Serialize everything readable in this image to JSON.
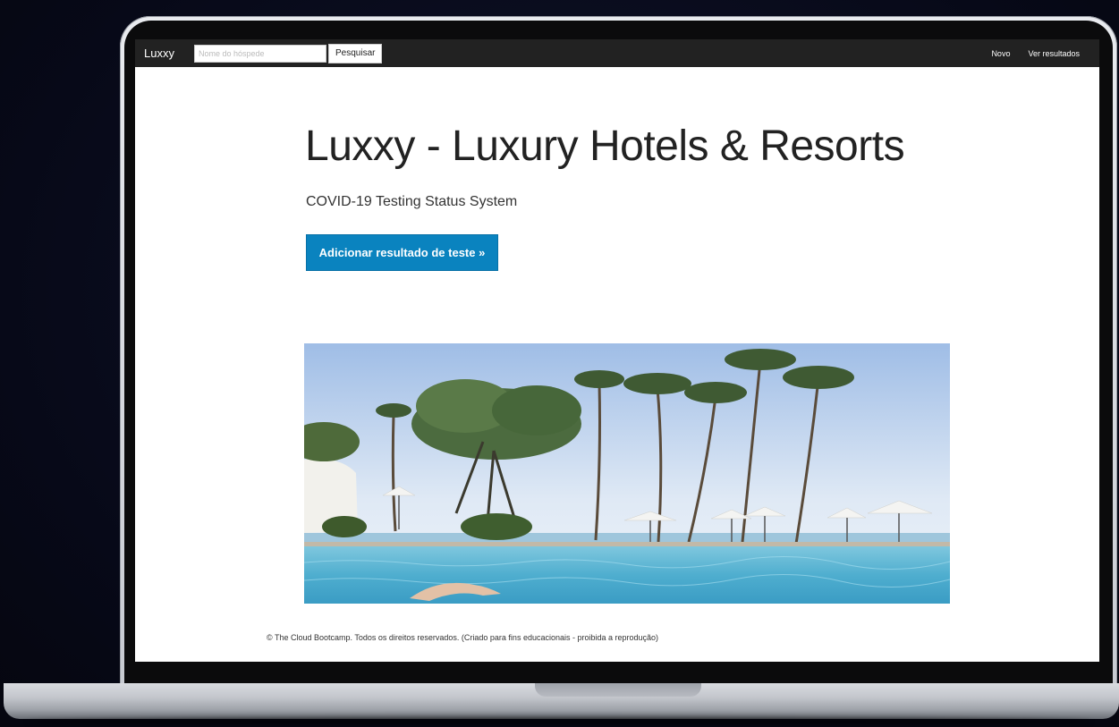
{
  "navbar": {
    "brand": "Luxxy",
    "search_placeholder": "Nome do hóspede",
    "search_button": "Pesquisar",
    "links": [
      "Novo",
      "Ver resultados"
    ]
  },
  "hero": {
    "title": "Luxxy - Luxury Hotels & Resorts",
    "subtitle": "COVID-19 Testing Status System",
    "cta_label": "Adicionar resultado de teste »"
  },
  "footer": {
    "text": "© The Cloud Bootcamp. Todos os direitos reservados. (Criado para fins educacionais - proibida a reprodução)"
  },
  "colors": {
    "navbar": "#222222",
    "cta": "#0a83bf",
    "sky": "#cfe0f3",
    "pool": "#5fb6d6"
  }
}
